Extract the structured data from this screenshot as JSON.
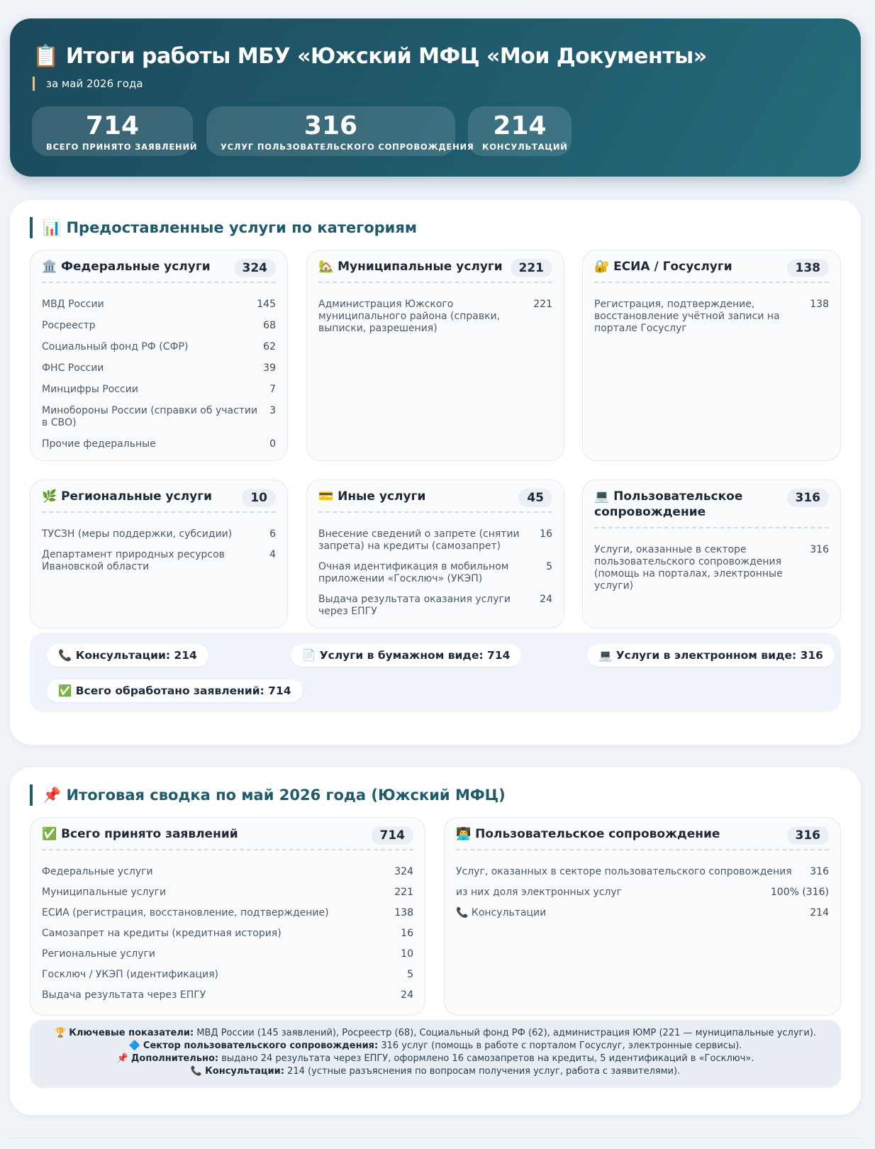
{
  "header": {
    "icon": "📋",
    "title": "Итоги работы МБУ «Южский МФЦ «Мои Документы»",
    "subtitle": "за май 2026 года",
    "stats": [
      {
        "value": "714",
        "label": "Всего принято заявлений"
      },
      {
        "value": "316",
        "label": "Услуг пользовательского сопровождения"
      },
      {
        "value": "214",
        "label": "Консультаций"
      }
    ]
  },
  "categories": {
    "title": "📊 Предоставленные услуги по категориям",
    "cards": [
      {
        "title": "🏛️ Федеральные услуги",
        "count": "324",
        "rows": [
          {
            "label": "МВД России",
            "value": "145"
          },
          {
            "label": "Росреестр",
            "value": "68"
          },
          {
            "label": "Социальный фонд РФ (СФР)",
            "value": "62"
          },
          {
            "label": "ФНС России",
            "value": "39"
          },
          {
            "label": "Минцифры России",
            "value": "7"
          },
          {
            "label": "Минобороны России (справки об участии в СВО)",
            "value": "3"
          },
          {
            "label": "Прочие федеральные",
            "value": "0"
          }
        ]
      },
      {
        "title": "🏡 Муниципальные услуги",
        "count": "221",
        "rows": [
          {
            "label": "Администрация Южского муниципального района (справки, выписки, разрешения)",
            "value": "221"
          }
        ]
      },
      {
        "title": "🔐 ЕСИА / Госуслуги",
        "count": "138",
        "rows": [
          {
            "label": "Регистрация, подтверждение, восстановление учётной записи на портале Госуслуг",
            "value": "138"
          }
        ]
      },
      {
        "title": "🌿 Региональные услуги",
        "count": "10",
        "rows": [
          {
            "label": "ТУСЗН (меры поддержки, субсидии)",
            "value": "6"
          },
          {
            "label": "Департамент природных ресурсов Ивановской области",
            "value": "4"
          }
        ]
      },
      {
        "title": "💳 Иные услуги",
        "count": "45",
        "rows": [
          {
            "label": "Внесение сведений о запрете (снятии запрета) на кредиты (самозапрет)",
            "value": "16"
          },
          {
            "label": "Очная идентификация в мобильном приложении «Госключ» (УКЭП)",
            "value": "5"
          },
          {
            "label": "Выдача результата оказания услуги через ЕПГУ",
            "value": "24"
          }
        ]
      },
      {
        "title": "💻 Пользовательское сопровождение",
        "count": "316",
        "rows": [
          {
            "label": "Услуги, оказанные в секторе пользовательского сопровождения (помощь на порталах, электронные услуги)",
            "value": "316"
          }
        ]
      }
    ],
    "chips": [
      "📞 Консультации: 214",
      "📄 Услуги в бумажном виде: 714",
      "💻 Услуги в электронном виде: 316",
      "✅ Всего обработано заявлений: 714"
    ]
  },
  "summary": {
    "title": "📌 Итоговая сводка по май 2026 года (Южский МФЦ)",
    "left": {
      "title": "✅ Всего принято заявлений",
      "count": "714",
      "rows": [
        {
          "label": "Федеральные услуги",
          "value": "324"
        },
        {
          "label": "Муниципальные услуги",
          "value": "221"
        },
        {
          "label": "ЕСИА (регистрация, восстановление, подтверждение)",
          "value": "138"
        },
        {
          "label": "Самозапрет на кредиты (кредитная история)",
          "value": "16"
        },
        {
          "label": "Региональные услуги",
          "value": "10"
        },
        {
          "label": "Госключ / УКЭП (идентификация)",
          "value": "5"
        },
        {
          "label": "Выдача результата через ЕПГУ",
          "value": "24"
        }
      ]
    },
    "right": {
      "title": "👨‍💻 Пользовательское сопровождение",
      "count": "316",
      "rows": [
        {
          "label": "Услуг, оказанных в секторе пользовательского сопровождения",
          "value": "316"
        },
        {
          "label": "из них доля электронных услуг",
          "value": "100% (316)"
        },
        {
          "label": "📞 Консультации",
          "value": "214"
        }
      ]
    },
    "notes": [
      {
        "icon": "🏆",
        "bold": "Ключевые показатели:",
        "text": " МВД России (145 заявлений), Росреестр (68), Социальный фонд РФ (62), администрация ЮМР (221 — муниципальные услуги)."
      },
      {
        "icon": "🔷",
        "bold": "Сектор пользовательского сопровождения:",
        "text": " 316 услуг (помощь в работе с порталом Госуслуг, электронные сервисы)."
      },
      {
        "icon": "📌",
        "bold": "Дополнительно:",
        "text": " выдано 24 результата через ЕПГУ, оформлено 16 самозапретов на кредиты, 5 идентификаций в «Госключ»."
      },
      {
        "icon": "📞",
        "bold": "Консультации:",
        "text": " 214 (устные разъяснения по вопросам получения услуг, работа с заявителями)."
      }
    ]
  }
}
